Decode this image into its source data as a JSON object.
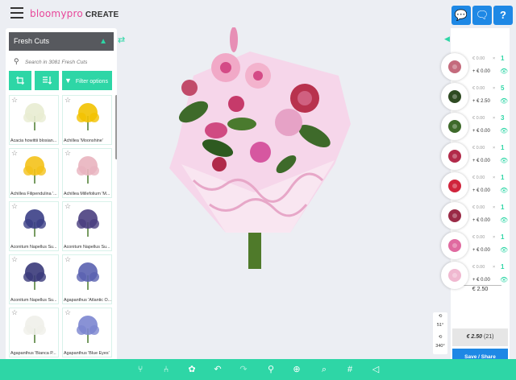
{
  "app": {
    "brand": "bloomypro",
    "mode": "CREATE"
  },
  "top_buttons": [
    {
      "icon": "chat-icon",
      "glyph": "💬"
    },
    {
      "icon": "messages-icon",
      "glyph": "🗨"
    },
    {
      "icon": "help-icon",
      "glyph": "?"
    }
  ],
  "left_panel": {
    "title": "Fresh Cuts",
    "search_placeholder": "Search in 3081 Fresh Cuts",
    "filter_label": "Filter options",
    "items": [
      {
        "name": "Acacia howittii blosian...",
        "color": "#e8ecd2"
      },
      {
        "name": "Achillea 'Moonshine'",
        "color": "#f2c200"
      },
      {
        "name": "Achillea Filipendulina '...",
        "color": "#f4c21a"
      },
      {
        "name": "Achillea Millefolium 'M...",
        "color": "#e9b4bf"
      },
      {
        "name": "Aconitum Napellus Su...",
        "color": "#3b3f86"
      },
      {
        "name": "Aconitum Napellus Su...",
        "color": "#4a3f80"
      },
      {
        "name": "Aconitum Napellus Su...",
        "color": "#3a3a7a"
      },
      {
        "name": "Agapanthus 'Atlantic O...",
        "color": "#5a62b0"
      },
      {
        "name": "Agapanthus 'Bianca P...",
        "color": "#f0f0ea"
      },
      {
        "name": "Agapanthus 'Blue Eyes'",
        "color": "#7c86d0"
      }
    ]
  },
  "right_panel": {
    "rows": [
      {
        "price": "€ 0.00",
        "qty": "1",
        "line": "+ € 0.00",
        "color": "#c46a7c"
      },
      {
        "price": "€ 0.00",
        "qty": "5",
        "line": "+ € 2.50",
        "color": "#2e4a22"
      },
      {
        "price": "€ 0.00",
        "qty": "3",
        "line": "+ € 0.00",
        "color": "#3e6a2a"
      },
      {
        "price": "€ 0.00",
        "qty": "1",
        "line": "+ € 0.00",
        "color": "#b22a4a"
      },
      {
        "price": "€ 0.00",
        "qty": "1",
        "line": "+ € 0.00",
        "color": "#d0243c"
      },
      {
        "price": "€ 0.00",
        "qty": "1",
        "line": "+ € 0.00",
        "color": "#9a2a46"
      },
      {
        "price": "€ 0.00",
        "qty": "1",
        "line": "+ € 0.00",
        "color": "#e06aa0"
      },
      {
        "price": "€ 0.00",
        "qty": "1",
        "line": "+ € 0.00",
        "color": "#f0b8d0"
      }
    ],
    "times": "×",
    "total": "€ 2.50",
    "summary_price": "€ 2.50",
    "summary_count": "(21)",
    "save_label": "Save / Share"
  },
  "rotation": {
    "angle1": "51°",
    "angle2": "340°"
  },
  "toolbar": [
    {
      "icon": "tree-icon",
      "glyph": "⑂",
      "dim": false
    },
    {
      "icon": "branch-icon",
      "glyph": "⑃",
      "dim": false
    },
    {
      "icon": "flower-icon",
      "glyph": "✿",
      "dim": false
    },
    {
      "icon": "undo-icon",
      "glyph": "↶",
      "dim": false
    },
    {
      "icon": "redo-icon",
      "glyph": "↷",
      "dim": true
    },
    {
      "icon": "wand-icon",
      "glyph": "⚲",
      "dim": false
    },
    {
      "icon": "target-icon",
      "glyph": "⊕",
      "dim": false
    },
    {
      "icon": "zoom-icon",
      "glyph": "⌕",
      "dim": false
    },
    {
      "icon": "grid-icon",
      "glyph": "#",
      "dim": false
    },
    {
      "icon": "compare-icon",
      "glyph": "◁",
      "dim": false
    }
  ]
}
